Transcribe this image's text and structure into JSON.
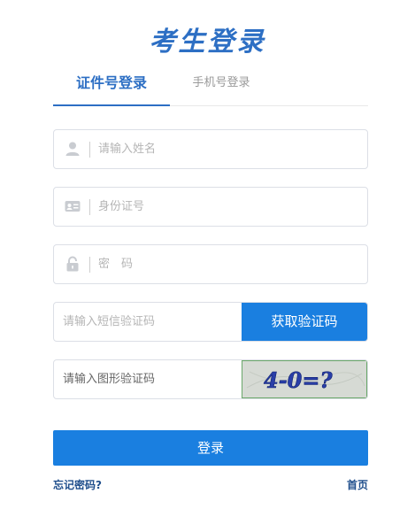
{
  "page": {
    "title": "考生登录"
  },
  "tabs": [
    {
      "label": "证件号登录",
      "active": true
    },
    {
      "label": "手机号登录",
      "active": false
    }
  ],
  "form": {
    "name_placeholder": "请输入姓名",
    "id_placeholder": "身份证号",
    "password_placeholder": "密　码",
    "sms_placeholder": "请输入短信验证码",
    "sms_button": "获取验证码",
    "captcha_placeholder": "请输入图形验证码",
    "captcha_text": "4-0=?",
    "login_button": "登录"
  },
  "footer": {
    "forgot": "忘记密码?",
    "home": "首页"
  },
  "colors": {
    "primary": "#1a7fe0",
    "title": "#2d6fc4",
    "link": "#1f4e8c"
  },
  "icons": {
    "name": "user-icon",
    "id": "id-card-icon",
    "password": "lock-icon"
  }
}
